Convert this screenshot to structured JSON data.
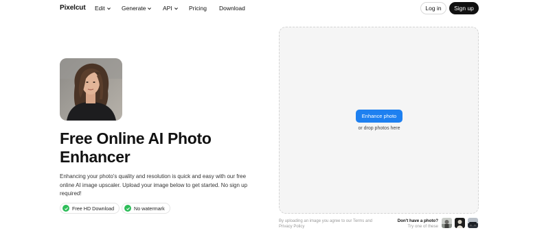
{
  "nav": {
    "logo": "Pixelcut",
    "items": [
      {
        "label": "Edit",
        "dropdown": true
      },
      {
        "label": "Generate",
        "dropdown": true
      },
      {
        "label": "API",
        "dropdown": true
      },
      {
        "label": "Pricing",
        "dropdown": false
      },
      {
        "label": "Download",
        "dropdown": false
      }
    ],
    "login": "Log in",
    "signup": "Sign up"
  },
  "hero": {
    "title_line1": "Free Online AI Photo",
    "title_line2": "Enhancer",
    "description": "Enhancing your photo's quality and resolution is quick and easy with our free online AI image upscaler. Upload your image below to get started. No sign up required!",
    "badges": [
      {
        "label": "Free HD Download",
        "icon": "check-icon"
      },
      {
        "label": "No watermark",
        "icon": "check-icon"
      }
    ]
  },
  "dropzone": {
    "button": "Enhance photo",
    "hint": "or drop photos here"
  },
  "footer": {
    "legal_prefix": "By uploading an image you agree to our ",
    "terms": "Terms",
    "and": " and ",
    "privacy": "Privacy Policy",
    "no_photo_title": "Don't have a photo?",
    "no_photo_sub": "Try one of these"
  },
  "colors": {
    "accent": "#1e80f0",
    "check": "#2ebd59",
    "dark": "#111111"
  }
}
